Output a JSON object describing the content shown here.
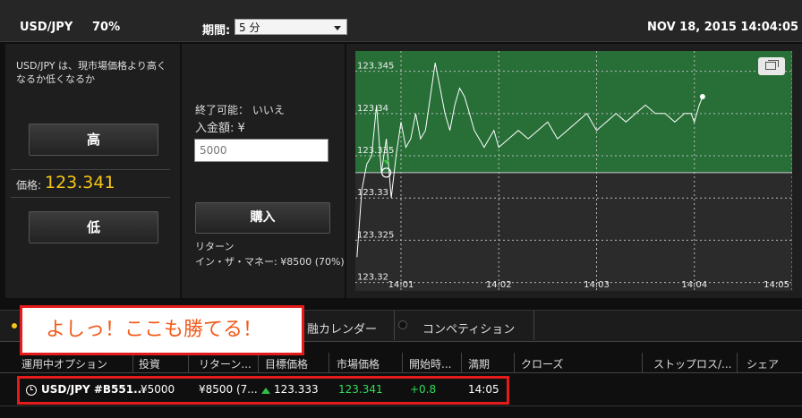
{
  "header": {
    "pair": "USD/JPY",
    "percent": "70%",
    "period_label": "期間:",
    "period_value": "5 分",
    "datetime": "NOV 18, 2015 14:04:05"
  },
  "left": {
    "description": "USD/JPY は、現市場価格より高くなるか低くなるか",
    "high_button": "高",
    "price_label": "価格:",
    "price_value": "123.341",
    "low_button": "低"
  },
  "middle": {
    "close_available": "終了可能： いいえ",
    "deposit_label": "入金額: ¥",
    "amount_value": "5000",
    "buy_button": "購入",
    "return_label": "リターン",
    "in_the_money": "イン・ザ・マネー: ¥8500 (70%)"
  },
  "chart_data": {
    "type": "line",
    "x": [
      "14:00:33",
      "14:00:36",
      "14:00:39",
      "14:00:42",
      "14:00:45",
      "14:00:48",
      "14:00:51",
      "14:00:54",
      "14:00:57",
      "14:01:00",
      "14:01:03",
      "14:01:06",
      "14:01:09",
      "14:01:12",
      "14:01:15",
      "14:01:18",
      "14:01:21",
      "14:01:24",
      "14:01:27",
      "14:01:30",
      "14:01:33",
      "14:01:36",
      "14:01:39",
      "14:01:42",
      "14:01:45",
      "14:01:48",
      "14:01:51",
      "14:01:54",
      "14:01:57",
      "14:02:00",
      "14:02:06",
      "14:02:12",
      "14:02:18",
      "14:02:24",
      "14:02:30",
      "14:02:36",
      "14:02:42",
      "14:02:48",
      "14:02:54",
      "14:03:00",
      "14:03:06",
      "14:03:12",
      "14:03:18",
      "14:03:24",
      "14:03:30",
      "14:03:36",
      "14:03:42",
      "14:03:48",
      "14:03:54",
      "14:03:58",
      "14:04:00",
      "14:04:03",
      "14:04:05"
    ],
    "values": [
      123.323,
      123.331,
      123.334,
      123.335,
      123.341,
      123.333,
      123.337,
      123.33,
      123.335,
      123.339,
      123.336,
      123.337,
      123.34,
      123.337,
      123.338,
      123.342,
      123.346,
      123.343,
      123.34,
      123.338,
      123.341,
      123.343,
      123.342,
      123.34,
      123.338,
      123.337,
      123.336,
      123.337,
      123.338,
      123.336,
      123.337,
      123.338,
      123.337,
      123.338,
      123.339,
      123.337,
      123.338,
      123.339,
      123.34,
      123.338,
      123.339,
      123.34,
      123.339,
      123.34,
      123.341,
      123.34,
      123.34,
      123.339,
      123.34,
      123.34,
      123.339,
      123.341,
      123.342
    ],
    "x_ticks": [
      "14:01",
      "14:02",
      "14:03",
      "14:04",
      "14:05"
    ],
    "y_ticks": [
      "123.32",
      "123.325",
      "123.33",
      "123.335",
      "123.34",
      "123.345"
    ],
    "xlim": [
      "14:00:32",
      "14:05:00"
    ],
    "ylim": [
      123.319,
      123.3474
    ],
    "strike": 123.333,
    "strike_time": "14:00:51",
    "colors": {
      "above": "#276f37",
      "below": "#2b2b2b",
      "line": "#ffffff",
      "marker": "#3fbf3f"
    },
    "grid": true
  },
  "tabs": {
    "calendar": "融カレンダー",
    "competition": "コンペティション"
  },
  "table": {
    "headers": [
      "運用中オプション",
      "投資",
      "リターン...",
      "目標価格",
      "市場価格",
      "開始時...",
      "満期",
      "クローズ",
      "ストップロス/...",
      "シェア"
    ],
    "row": {
      "option": "USD/JPY #B551...",
      "investment": "¥5000",
      "return": "¥8500 (7...",
      "target": "123.333",
      "market": "123.341",
      "change": "+0.8",
      "expiry": "14:05"
    }
  },
  "callout": {
    "text": "よしっ！ここも勝てる！"
  }
}
